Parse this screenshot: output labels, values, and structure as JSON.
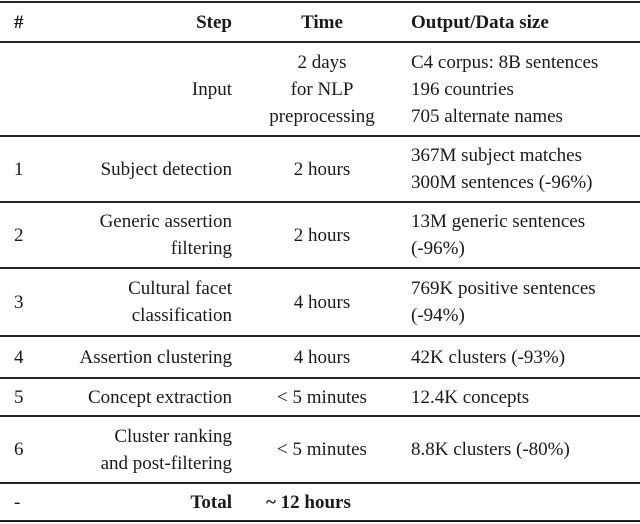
{
  "table": {
    "headers": [
      "#",
      "Step",
      "Time",
      "Output/Data size"
    ],
    "rows": [
      {
        "num": "",
        "step": [
          "Input"
        ],
        "time": [
          "2 days",
          "for NLP",
          "preprocessing"
        ],
        "output": [
          "C4 corpus: 8B sentences",
          "196 countries",
          "705 alternate names"
        ]
      },
      {
        "num": "1",
        "step": [
          "Subject detection"
        ],
        "time": [
          "2 hours"
        ],
        "output": [
          "367M subject matches",
          "300M sentences (-96%)"
        ]
      },
      {
        "num": "2",
        "step": [
          "Generic assertion",
          "filtering"
        ],
        "time": [
          "2 hours"
        ],
        "output": [
          "13M generic sentences",
          "(-96%)"
        ]
      },
      {
        "num": "3",
        "step": [
          "Cultural facet",
          "classification"
        ],
        "time": [
          "4 hours"
        ],
        "output": [
          "769K positive sentences",
          "(-94%)"
        ]
      },
      {
        "num": "4",
        "step": [
          "Assertion clustering"
        ],
        "time": [
          "4 hours"
        ],
        "output": [
          "42K clusters (-93%)"
        ]
      },
      {
        "num": "5",
        "step": [
          "Concept extraction"
        ],
        "time": [
          "< 5 minutes"
        ],
        "output": [
          "12.4K concepts"
        ]
      },
      {
        "num": "6",
        "step": [
          "Cluster ranking",
          "and post-filtering"
        ],
        "time": [
          "< 5 minutes"
        ],
        "output": [
          "8.8K clusters (-80%)"
        ]
      },
      {
        "num": "-",
        "step": [
          "Total"
        ],
        "time": [
          "~ 12 hours"
        ],
        "output": []
      }
    ]
  }
}
